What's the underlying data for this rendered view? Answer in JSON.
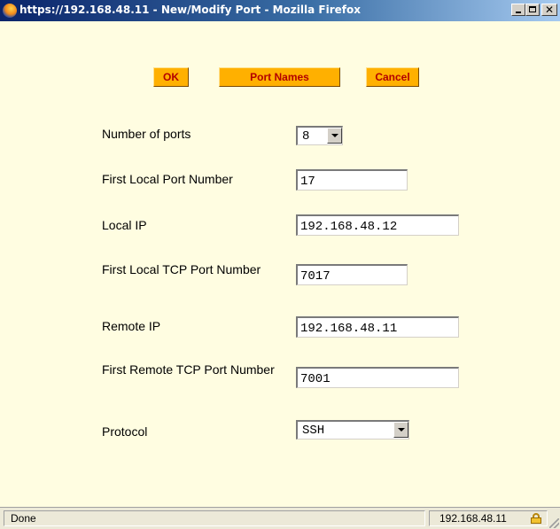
{
  "window": {
    "title": "https://192.168.48.11 - New/Modify Port - Mozilla Firefox"
  },
  "buttons": {
    "ok": "OK",
    "port_names": "Port Names",
    "cancel": "Cancel"
  },
  "form": {
    "number_of_ports": {
      "label": "Number of ports",
      "value": "8"
    },
    "first_local_port_number": {
      "label": "First Local Port Number",
      "value": "17"
    },
    "local_ip": {
      "label": "Local IP",
      "value": "192.168.48.12"
    },
    "first_local_tcp_port": {
      "label": "First Local TCP Port Number",
      "value": "7017"
    },
    "remote_ip": {
      "label": "Remote IP",
      "value": "192.168.48.11"
    },
    "first_remote_tcp_port": {
      "label": "First Remote TCP Port Number",
      "value": "7001"
    },
    "protocol": {
      "label": "Protocol",
      "value": "SSH"
    }
  },
  "statusbar": {
    "status": "Done",
    "host": "192.168.48.11"
  },
  "colors": {
    "page_background": "#fffde1",
    "button_background": "#ffb000",
    "button_text": "#b30000",
    "titlebar": "#0a246a"
  },
  "icons": {
    "app": "firefox-icon",
    "lock": "lock-icon",
    "minimize": "minimize-icon",
    "maximize": "maximize-icon",
    "close": "close-icon"
  }
}
